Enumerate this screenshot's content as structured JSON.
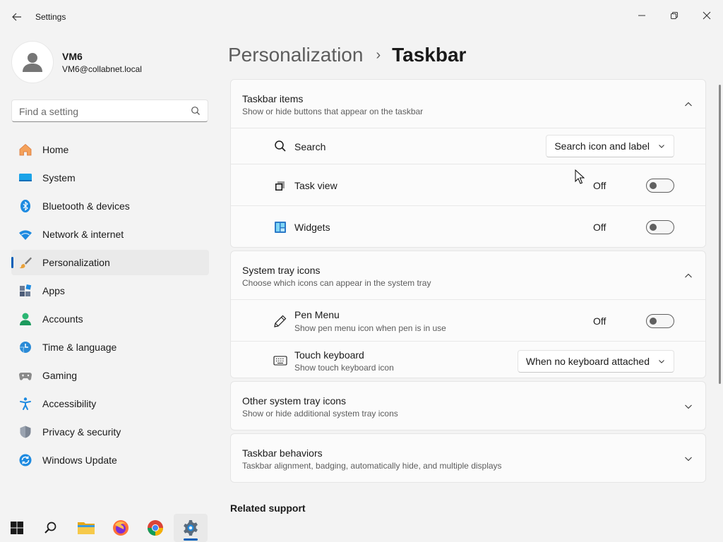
{
  "window": {
    "title": "Settings",
    "controls": {
      "minimize": "minimize",
      "maximize": "maximize",
      "close": "close"
    }
  },
  "user": {
    "name": "VM6",
    "email": "VM6@collabnet.local"
  },
  "search": {
    "placeholder": "Find a setting"
  },
  "sidebar": {
    "items": [
      {
        "label": "Home",
        "icon": "home-icon",
        "active": false
      },
      {
        "label": "System",
        "icon": "system-icon",
        "active": false
      },
      {
        "label": "Bluetooth & devices",
        "icon": "bluetooth-icon",
        "active": false
      },
      {
        "label": "Network & internet",
        "icon": "wifi-icon",
        "active": false
      },
      {
        "label": "Personalization",
        "icon": "brush-icon",
        "active": true
      },
      {
        "label": "Apps",
        "icon": "apps-icon",
        "active": false
      },
      {
        "label": "Accounts",
        "icon": "person-icon",
        "active": false
      },
      {
        "label": "Time & language",
        "icon": "clock-globe-icon",
        "active": false
      },
      {
        "label": "Gaming",
        "icon": "gamepad-icon",
        "active": false
      },
      {
        "label": "Accessibility",
        "icon": "accessibility-icon",
        "active": false
      },
      {
        "label": "Privacy & security",
        "icon": "shield-icon",
        "active": false
      },
      {
        "label": "Windows Update",
        "icon": "update-icon",
        "active": false
      }
    ]
  },
  "header": {
    "parent": "Personalization",
    "separator": "›",
    "current": "Taskbar"
  },
  "groups": {
    "taskbar_items": {
      "title": "Taskbar items",
      "subtitle": "Show or hide buttons that appear on the taskbar",
      "expanded": true,
      "rows": {
        "search": {
          "label": "Search",
          "value": "Search icon and label"
        },
        "task_view": {
          "label": "Task view",
          "state": "Off"
        },
        "widgets": {
          "label": "Widgets",
          "state": "Off"
        }
      }
    },
    "system_tray": {
      "title": "System tray icons",
      "subtitle": "Choose which icons can appear in the system tray",
      "expanded": true,
      "rows": {
        "pen_menu": {
          "label": "Pen Menu",
          "sub": "Show pen menu icon when pen is in use",
          "state": "Off"
        },
        "touch_keyboard": {
          "label": "Touch keyboard",
          "sub": "Show touch keyboard icon",
          "value": "When no keyboard attached"
        }
      }
    },
    "other_tray": {
      "title": "Other system tray icons",
      "subtitle": "Show or hide additional system tray icons",
      "expanded": false
    },
    "behaviors": {
      "title": "Taskbar behaviors",
      "subtitle": "Taskbar alignment, badging, automatically hide, and multiple displays",
      "expanded": false
    }
  },
  "related": {
    "title": "Related support"
  },
  "taskbar": {
    "items": [
      "start-icon",
      "search-icon",
      "file-explorer-icon",
      "firefox-icon",
      "chrome-icon",
      "settings-icon"
    ],
    "active": "settings-icon"
  },
  "colors": {
    "accent": "#005fb8",
    "background": "#f3f3f3",
    "card": "#fbfbfb"
  }
}
